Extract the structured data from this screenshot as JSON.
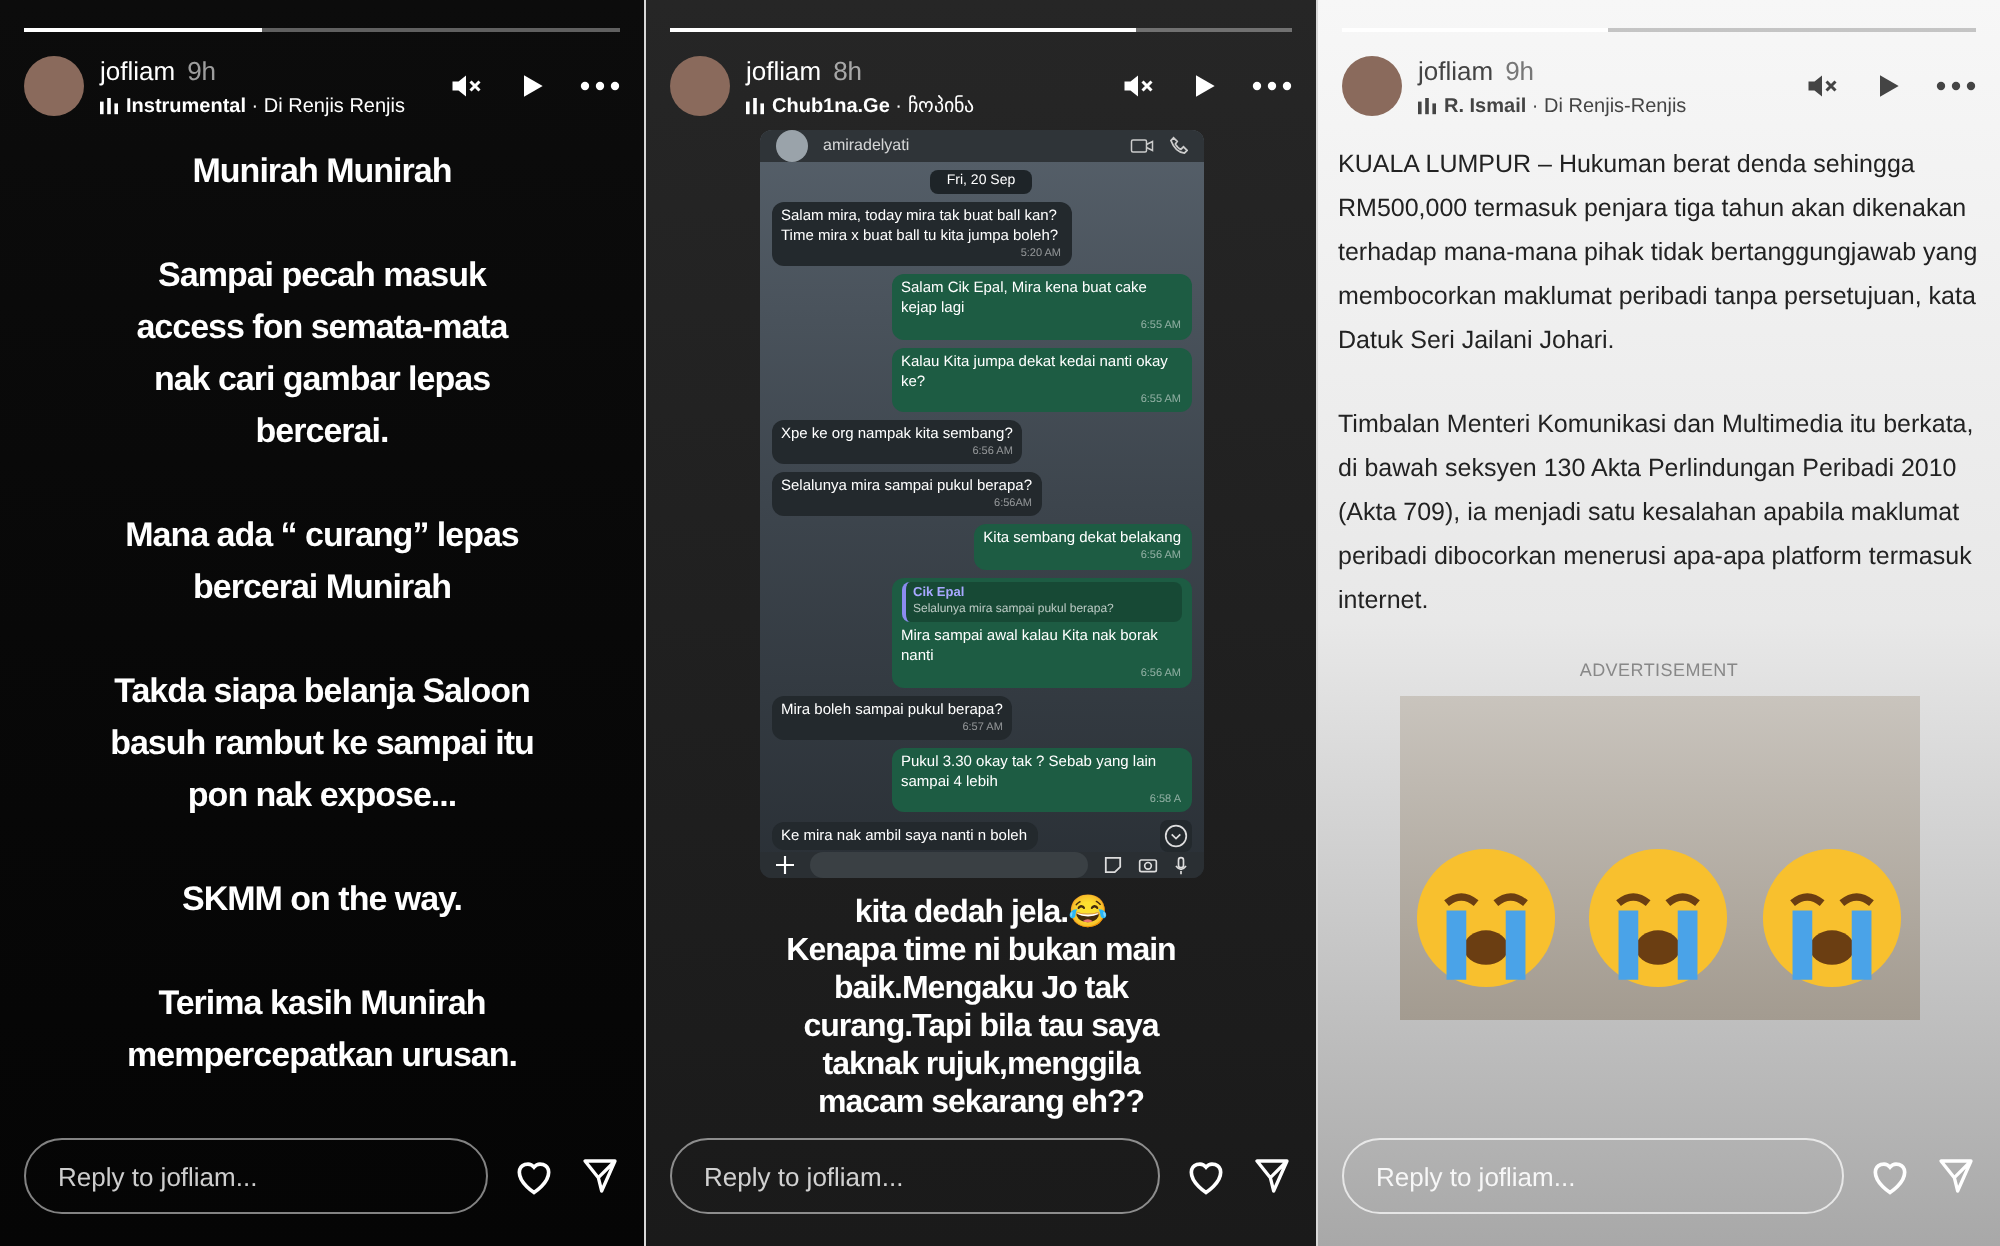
{
  "stories": [
    {
      "kind": "text",
      "progress": {
        "level": 0.4
      },
      "user": "jofliam",
      "time": "9h",
      "music": {
        "artist": "Instrumental",
        "separator": "·",
        "song": "Di Renjis Renjis"
      },
      "blocks": [
        [
          "Munirah Munirah"
        ],
        [
          "Sampai pecah masuk",
          "access fon semata-mata",
          "nak cari gambar lepas",
          "bercerai."
        ],
        [
          "Mana ada “ curang” lepas",
          "bercerai Munirah"
        ],
        [
          "Takda siapa belanja Saloon",
          "basuh rambut ke sampai itu",
          "pon nak expose..."
        ],
        [
          "SKMM on the way."
        ],
        [
          "Terima kasih Munirah",
          "mempercepatkan urusan."
        ]
      ],
      "reply": {
        "placeholder": "Reply to jofliam..."
      }
    },
    {
      "kind": "chat",
      "progress": {
        "level": 0.75
      },
      "user": "jofliam",
      "time": "8h",
      "music": {
        "artist": "Chub1na.Ge",
        "separator": "·",
        "song": "ჩოპინა"
      },
      "chat": {
        "contact": "amiradelyati",
        "date": "Fri, 20 Sep",
        "messages": [
          {
            "outgoing": false,
            "text": "Salam mira, today mira tak buat ball kan? Time mira x buat ball tu kita jumpa boleh?",
            "time": "5:20 AM"
          },
          {
            "outgoing": true,
            "text": "Salam Cik Epal, Mira kena buat cake kejap lagi",
            "time": "6:55 AM"
          },
          {
            "outgoing": true,
            "text": "Kalau Kita jumpa dekat kedai nanti okay ke?",
            "time": "6:55 AM"
          },
          {
            "outgoing": false,
            "text": "Xpe ke org nampak kita sembang?",
            "time": "6:56 AM"
          },
          {
            "outgoing": false,
            "text": "Selalunya mira sampai pukul berapa?",
            "time": "6:56AM"
          },
          {
            "outgoing": true,
            "text": "Kita sembang dekat belakang",
            "time": "6:56 AM"
          },
          {
            "outgoing": true,
            "quote": {
              "name": "Cik Epal",
              "text": "Selalunya mira sampai pukul berapa?"
            },
            "text": "Mira sampai awal kalau Kita nak borak nanti",
            "time": "6:56 AM"
          },
          {
            "outgoing": false,
            "text": "Mira boleh sampai pukul berapa?",
            "time": "6:57 AM"
          },
          {
            "outgoing": true,
            "text": "Pukul 3.30 okay tak ? Sebab yang lain sampai 4 lebih",
            "time": "6:58 A"
          },
          {
            "outgoing": false,
            "text": "Ke mira nak ambil saya nanti n boleh"
          }
        ]
      },
      "lines": [
        "kita dedah jela.😂",
        "Kenapa time ni bukan main",
        "baik.Mengaku Jo tak",
        "curang.Tapi bila tau saya",
        "taknak rujuk,menggila",
        "macam sekarang eh??"
      ],
      "reply": {
        "placeholder": "Reply to jofliam..."
      }
    },
    {
      "kind": "article",
      "progress": {
        "level": 0.42
      },
      "user": "jofliam",
      "time": "9h",
      "music": {
        "artist": "R. Ismail",
        "separator": "·",
        "song": "Di Renjis-Renjis"
      },
      "paragraphs": [
        "KUALA LUMPUR – Hukuman berat denda sehingga RM500,000 termasuk penjara tiga tahun akan dikenakan terhadap mana-mana pihak tidak bertanggungjawab yang membocorkan maklumat peribadi tanpa persetujuan, kata Datuk Seri Jailani Johari.",
        "Timbalan Menteri Komunikasi dan Multimedia itu berkata, di bawah seksyen 130 Akta Perlindungan Peribadi 2010 (Akta 709), ia menjadi satu kesalahan apabila maklumat peribadi dibocorkan menerusi apa-apa platform termasuk internet."
      ],
      "ad_label": "ADVERTISEMENT",
      "reply": {
        "placeholder": "Reply to jofliam..."
      }
    }
  ]
}
